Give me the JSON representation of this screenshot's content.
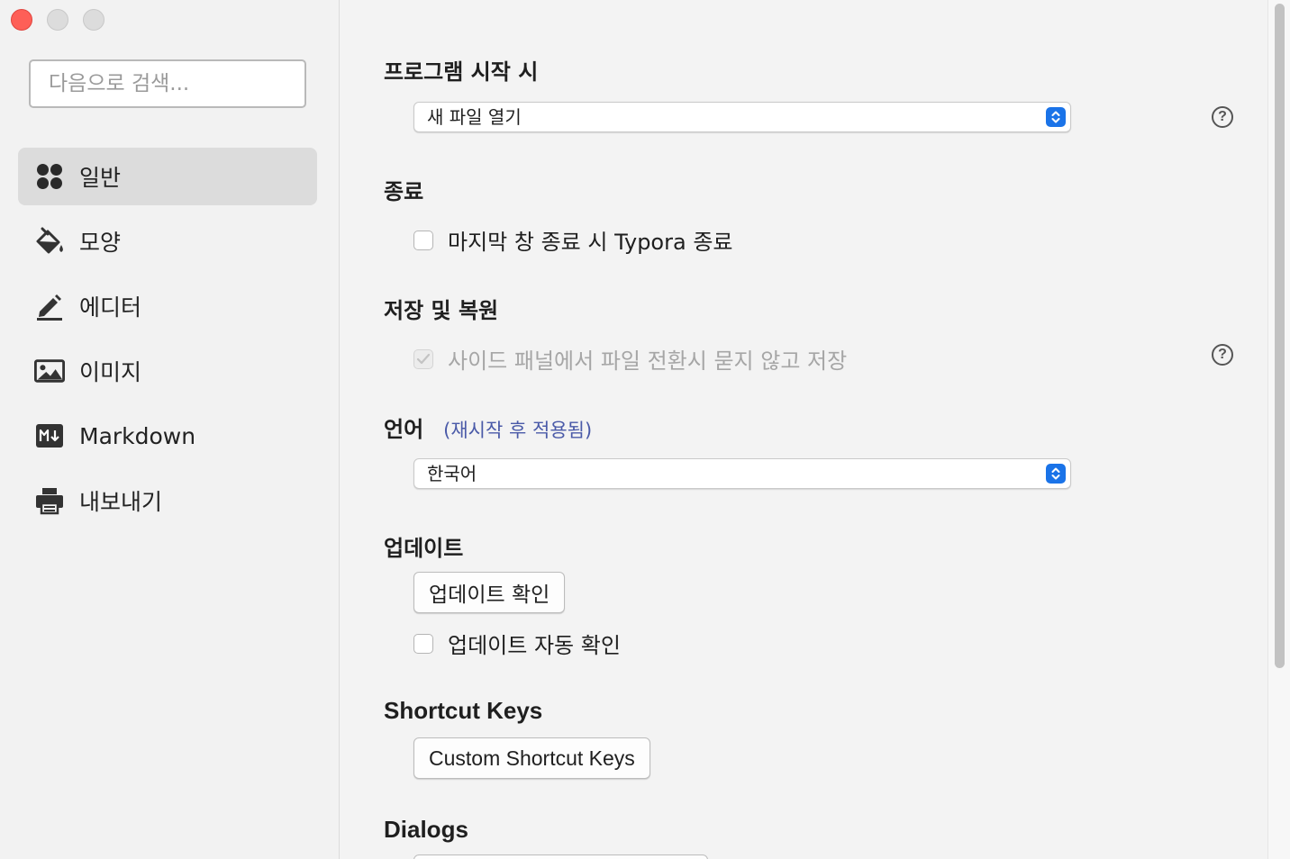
{
  "window": {
    "controls": [
      "close",
      "minimize",
      "maximize"
    ]
  },
  "sidebar": {
    "search_placeholder": "다음으로 검색...",
    "items": [
      {
        "label": "일반",
        "icon": "general-grid-icon",
        "active": true
      },
      {
        "label": "모양",
        "icon": "paint-bucket-icon",
        "active": false
      },
      {
        "label": "에디터",
        "icon": "pencil-icon",
        "active": false
      },
      {
        "label": "이미지",
        "icon": "image-icon",
        "active": false
      },
      {
        "label": "Markdown",
        "icon": "markdown-icon",
        "active": false
      },
      {
        "label": "내보내기",
        "icon": "printer-icon",
        "active": false
      }
    ]
  },
  "sections": {
    "startup": {
      "title": "프로그램 시작 시",
      "select_value": "새 파일 열기"
    },
    "quit": {
      "title": "종료",
      "checkbox_label": "마지막 창 종료 시 Typora 종료",
      "checked": false
    },
    "save": {
      "title": "저장 및 복원",
      "checkbox_label": "사이드 패널에서 파일 전환시 묻지 않고 저장",
      "checked": true,
      "disabled": true
    },
    "language": {
      "title": "언어",
      "hint": "(재시작 후 적용됨)",
      "select_value": "한국어"
    },
    "update": {
      "title": "업데이트",
      "button_label": "업데이트 확인",
      "checkbox_label": "업데이트 자동 확인",
      "checked": false
    },
    "shortcuts": {
      "title": "Shortcut Keys",
      "button_label": "Custom Shortcut Keys"
    },
    "dialogs": {
      "title": "Dialogs"
    }
  },
  "colors": {
    "close": "#fe5f57",
    "accent": "#1a73e8",
    "hint": "#4a5aa8",
    "active_item": "#dcdcdc"
  }
}
